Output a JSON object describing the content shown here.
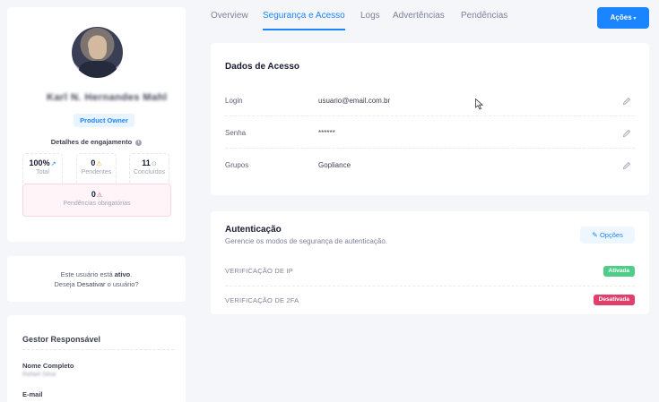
{
  "profile": {
    "name": "Karl N. Hernandes Mahl",
    "role": "Product Owner",
    "engagement_title": "Detalhes de engajamento",
    "stats": [
      {
        "value": "100%",
        "label": "Total"
      },
      {
        "value": "0",
        "label": "Pendentes"
      },
      {
        "value": "11",
        "label": "Concluídos"
      }
    ],
    "mandatory": {
      "value": "0",
      "label": "Pendências obrigatórias"
    }
  },
  "status": {
    "line1_prefix": "Este usuário está",
    "line1_state": "ativo",
    "line1_suffix": ".",
    "line2_prefix": "Deseja",
    "line2_link": "Desativar",
    "line2_suffix": "o usuário?"
  },
  "manager": {
    "title": "Gestor Responsável",
    "full_name_label": "Nome Completo",
    "full_name_value": "Rafael Silva",
    "email_label": "E-mail"
  },
  "tabs": [
    {
      "label": "Overview"
    },
    {
      "label": "Segurança e Acesso"
    },
    {
      "label": "Logs"
    },
    {
      "label": "Advertências"
    },
    {
      "label": "Pendências"
    }
  ],
  "actions_label": "Ações",
  "access": {
    "title": "Dados de Acesso",
    "rows": [
      {
        "label": "Login",
        "value": "usuario@email.com.br"
      },
      {
        "label": "Senha",
        "value": "******"
      },
      {
        "label": "Grupos",
        "value": "Gopliance"
      }
    ]
  },
  "auth": {
    "title": "Autenticação",
    "subtitle": "Gerencie os modos de segurança de autenticação.",
    "options_label": "Opções",
    "items": [
      {
        "label": "VERIFICAÇÃO DE IP",
        "status": "Ativada"
      },
      {
        "label": "VERIFICAÇÃO DE 2FA",
        "status": "Desativada"
      }
    ]
  },
  "colors": {
    "accent": "#1b84ff",
    "success": "#50cd89",
    "danger": "#e0406b"
  }
}
